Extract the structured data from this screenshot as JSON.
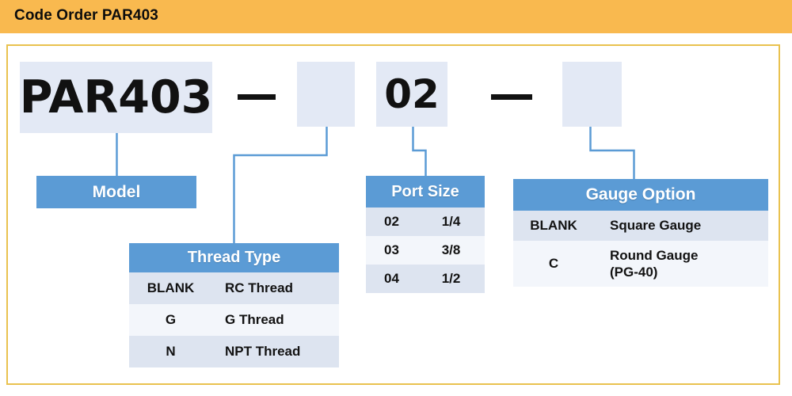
{
  "header": {
    "title": "Code Order PAR403",
    "band_color": "#F9B94F",
    "title_color": "#0D0D0D"
  },
  "frame": {
    "border_color": "#E9C24F",
    "background": "#FFFFFF"
  },
  "colors": {
    "code_box_bg": "#E3E9F5",
    "table_header_bg": "#5B9BD5",
    "table_row_odd": "#DDE4F0",
    "table_row_even": "#F3F6FB",
    "connector_line": "#5B9BD5",
    "text_dark": "#121212"
  },
  "code_string": {
    "segments": [
      {
        "name": "model",
        "value": "PAR403",
        "filled": true
      },
      {
        "name": "separator-1",
        "value": "—",
        "filled": false
      },
      {
        "name": "thread_type",
        "value": "",
        "filled": true
      },
      {
        "name": "port_size",
        "value": "02",
        "filled": true
      },
      {
        "name": "separator-2",
        "value": "—",
        "filled": false
      },
      {
        "name": "gauge_option",
        "value": "",
        "filled": true
      }
    ],
    "model_value": "PAR403",
    "thread_value": "",
    "port_value": "02",
    "gauge_value": "",
    "dash_1": "—",
    "dash_2": "—"
  },
  "model": {
    "label": "Model"
  },
  "thread_type": {
    "title": "Thread Type",
    "rows": [
      {
        "code": "BLANK",
        "desc": "RC Thread"
      },
      {
        "code": "G",
        "desc": "G Thread"
      },
      {
        "code": "N",
        "desc": "NPT Thread"
      }
    ]
  },
  "port_size": {
    "title": "Port Size",
    "rows": [
      {
        "code": "02",
        "desc": "1/4"
      },
      {
        "code": "03",
        "desc": "3/8"
      },
      {
        "code": "04",
        "desc": "1/2"
      }
    ]
  },
  "gauge_option": {
    "title": "Gauge Option",
    "rows": [
      {
        "code": "BLANK",
        "desc": "Square Gauge",
        "desc_line2": ""
      },
      {
        "code": "C",
        "desc": "Round Gauge",
        "desc_line2": "(PG-40)"
      }
    ]
  }
}
